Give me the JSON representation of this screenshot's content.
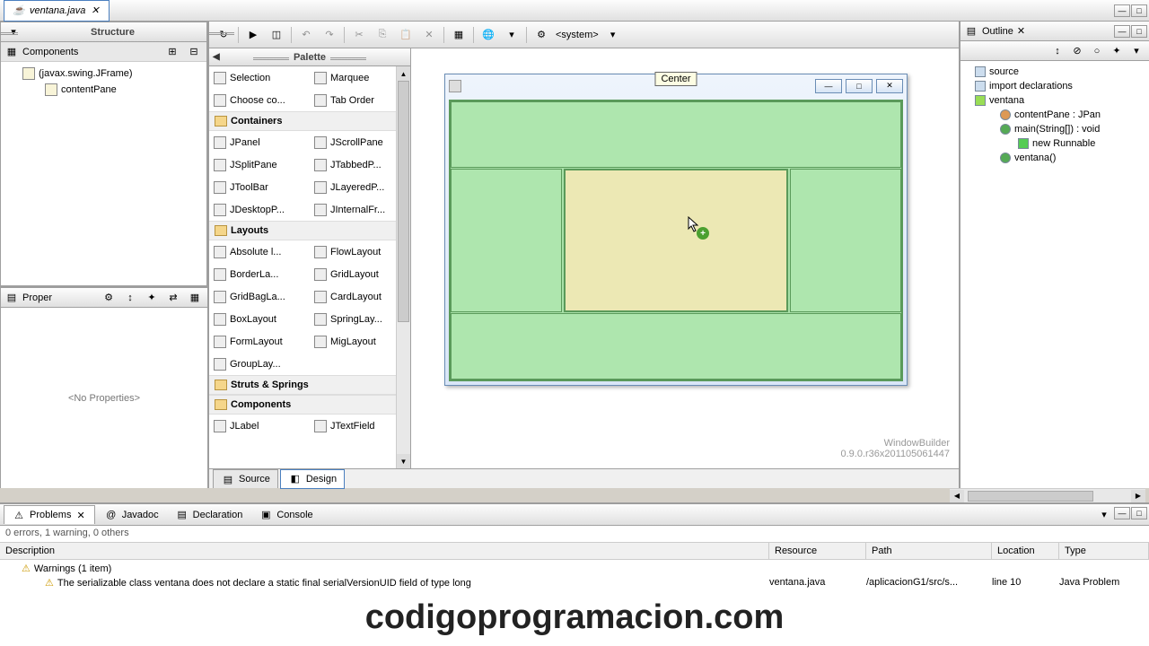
{
  "file_tab": {
    "name": "ventana.java"
  },
  "structure": {
    "title": "Structure",
    "components_label": "Components",
    "tree": {
      "root": "(javax.swing.JFrame)",
      "child": "contentPane"
    }
  },
  "properties": {
    "label": "Proper",
    "empty_text": "<No Properties>"
  },
  "palette": {
    "title": "Palette",
    "selection": "Selection",
    "marquee": "Marquee",
    "choose": "Choose co...",
    "taborder": "Tab Order",
    "cat_containers": "Containers",
    "containers": [
      "JPanel",
      "JScrollPane",
      "JSplitPane",
      "JTabbedP...",
      "JToolBar",
      "JLayeredP...",
      "JDesktopP...",
      "JInternalFr..."
    ],
    "cat_layouts": "Layouts",
    "layouts": [
      "Absolute l...",
      "FlowLayout",
      "BorderLa...",
      "GridLayout",
      "GridBagLa...",
      "CardLayout",
      "BoxLayout",
      "SpringLay...",
      "FormLayout",
      "MigLayout",
      "GroupLay..."
    ],
    "cat_struts": "Struts & Springs",
    "cat_components": "Components",
    "components": [
      "JLabel",
      "JTextField"
    ]
  },
  "designer": {
    "system_label": "<system>",
    "center_label": "Center",
    "wb_name": "WindowBuilder",
    "wb_version": "0.9.0.r36x201105061447"
  },
  "tabs": {
    "source": "Source",
    "design": "Design"
  },
  "outline": {
    "title": "Outline",
    "items": {
      "source": "source",
      "imports": "import declarations",
      "class": "ventana",
      "field": "contentPane : JPan",
      "main": "main(String[]) : void",
      "runnable": "new Runnable",
      "ctor": "ventana()"
    }
  },
  "bottom": {
    "tabs": {
      "problems": "Problems",
      "javadoc": "Javadoc",
      "declaration": "Declaration",
      "console": "Console"
    },
    "status": "0 errors, 1 warning, 0 others",
    "columns": {
      "desc": "Description",
      "resource": "Resource",
      "path": "Path",
      "location": "Location",
      "type": "Type"
    },
    "warning_group": "Warnings (1 item)",
    "warning": {
      "desc": "The serializable class ventana does not declare a static final serialVersionUID field of type long",
      "resource": "ventana.java",
      "path": "/aplicacionG1/src/s...",
      "location": "line 10",
      "type": "Java Problem"
    }
  },
  "watermark": "codigoprogramacion.com"
}
